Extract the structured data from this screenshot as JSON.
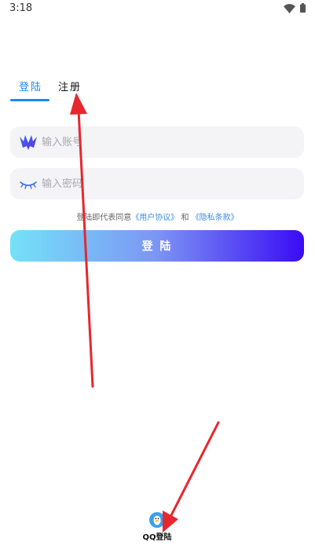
{
  "status_bar": {
    "time": "3:18"
  },
  "tabs": {
    "login": "登陆",
    "register": "注册"
  },
  "form": {
    "account_placeholder": "输入账号",
    "password_placeholder": "输入密码"
  },
  "agreement": {
    "prefix": "登陆即代表同意",
    "user_agreement": "《用户协议》",
    "and": "和",
    "privacy_policy": "《隐私条款》"
  },
  "login_button": "登 陆",
  "qq_login": {
    "label": "QQ登陆",
    "icon": "qq-penguin-icon"
  },
  "colors": {
    "accent": "#1e88f5",
    "link": "#3a8ee8",
    "field_bg": "#f4f4f6",
    "gradient_start": "#74e2f8",
    "gradient_end": "#3a0bf5",
    "annotation_arrow": "#e8262e"
  }
}
